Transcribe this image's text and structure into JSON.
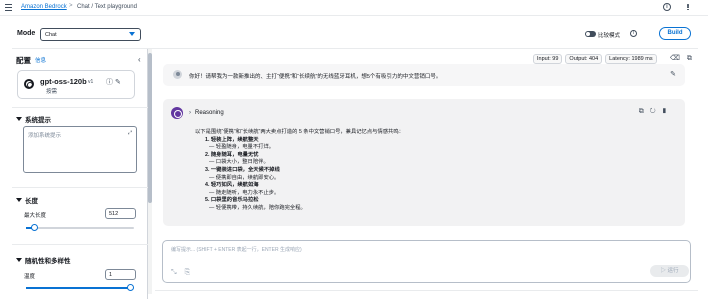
{
  "breadcrumb": {
    "root": "Amazon Bedrock",
    "separator": ">",
    "current": "Chat / Text playground"
  },
  "mode": {
    "label": "Mode",
    "selected": "Chat"
  },
  "header_actions": {
    "compare_label": "比较模式",
    "build_label": "Build"
  },
  "config": {
    "title": "配置",
    "info_link": "信息",
    "model": {
      "name": "gpt-oss-120b",
      "version": "v1",
      "mode": "按需"
    },
    "system_prompt": {
      "heading": "系统提示",
      "placeholder": "添加系统提示"
    },
    "length": {
      "heading": "长度",
      "max_length_label": "最大长度",
      "max_length_value": "512",
      "slider_fraction": 0.05
    },
    "randomness": {
      "heading": "随机性和多样性",
      "temperature_label": "温度",
      "temperature_value": "1",
      "slider_fraction": 1.0
    }
  },
  "metrics": {
    "input": "Input: 99",
    "output": "Output: 404",
    "latency": "Latency: 1989 ms"
  },
  "user_message": "你好！请帮我为一款新推出的、主打“便携”和“长续航”的无线蓝牙耳机，想5个有吸引力的中文营销口号。",
  "reply": {
    "reasoning_label": "Reasoning",
    "intro": "以下是围绕“便携”和“长续航”两大卖点打造的 5 条中文营销口号，兼具记忆点与情感共鸣：",
    "items": [
      {
        "title": "1. 轻装上阵，续航整天",
        "desc": "— 轻盈随身，电量不打烊。"
      },
      {
        "title": "2. 随身随耳，电量无忧",
        "desc": "— 口袋大小，整日陪伴。"
      },
      {
        "title": "3. 一键装进口袋，全天候不掉线",
        "desc": "— 便携即自由，续航即安心。"
      },
      {
        "title": "4. 轻巧如风，续航如海",
        "desc": "— 随走随听，电力永不止步。"
      },
      {
        "title": "5. 口袋里的音乐马拉松",
        "desc": "— 轻便携带，持久续航，陪你跑完全程。"
      }
    ]
  },
  "composer": {
    "placeholder": "编写提示... (SHIFT + ENTER 表起一行，ENTER 生成响应)",
    "run_label": "▷ 运行"
  },
  "colors": {
    "accent": "#0972d3",
    "reasoning_avatar": "#6237a0"
  }
}
